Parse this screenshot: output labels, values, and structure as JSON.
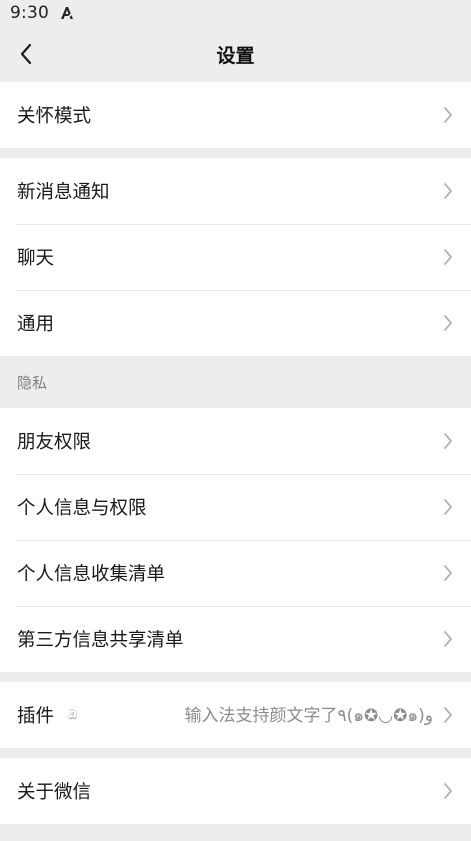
{
  "status": {
    "time": "9:30",
    "notification_icon": "a-font-icon"
  },
  "nav": {
    "title": "设置",
    "back_icon": "chevron-left-icon"
  },
  "groups": {
    "care_mode": {
      "label": "关怀模式"
    },
    "notifications": {
      "label": "新消息通知"
    },
    "chat": {
      "label": "聊天"
    },
    "general": {
      "label": "通用"
    },
    "privacy_header": "隐私",
    "friend_permissions": {
      "label": "朋友权限"
    },
    "personal_info_permissions": {
      "label": "个人信息与权限"
    },
    "personal_info_collection": {
      "label": "个人信息收集清单"
    },
    "third_party_sharing": {
      "label": "第三方信息共享清单"
    },
    "plugins": {
      "label": "插件",
      "sticker": "ඔ",
      "value": "输入法支持颜文字了٩(๑✪◡✪๑)و"
    },
    "about": {
      "label": "关于微信"
    }
  },
  "colors": {
    "background": "#ededed",
    "row": "#ffffff",
    "divider": "#e6e6e6",
    "chevron": "#b2b2b2"
  }
}
